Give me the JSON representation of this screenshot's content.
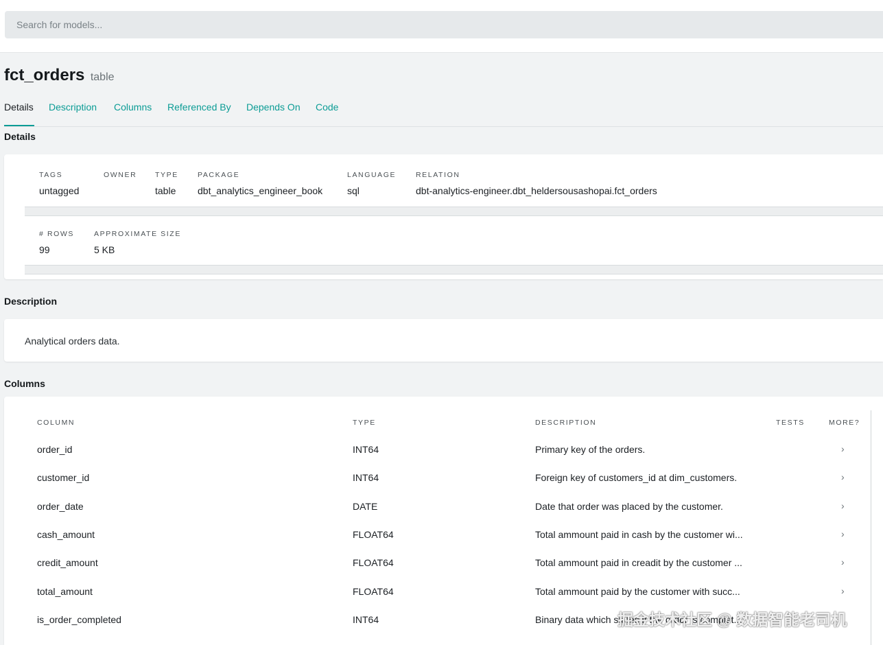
{
  "search": {
    "placeholder": "Search for models..."
  },
  "model": {
    "name": "fct_orders",
    "kind": "table"
  },
  "tabs": [
    {
      "label": "Details"
    },
    {
      "label": "Description"
    },
    {
      "label": "Columns"
    },
    {
      "label": "Referenced By"
    },
    {
      "label": "Depends On"
    },
    {
      "label": "Code"
    }
  ],
  "details": {
    "heading": "Details",
    "tags": {
      "label": "TAGS",
      "value": "untagged"
    },
    "owner": {
      "label": "OWNER",
      "value": ""
    },
    "type": {
      "label": "TYPE",
      "value": "table"
    },
    "package": {
      "label": "PACKAGE",
      "value": "dbt_analytics_engineer_book"
    },
    "language": {
      "label": "LANGUAGE",
      "value": "sql"
    },
    "relation": {
      "label": "RELATION",
      "value": "dbt-analytics-engineer.dbt_heldersousashopai.fct_orders"
    },
    "rows": {
      "label": "# ROWS",
      "value": "99"
    },
    "size": {
      "label": "APPROXIMATE SIZE",
      "value": "5 KB"
    }
  },
  "description": {
    "heading": "Description",
    "text": "Analytical orders data."
  },
  "columns": {
    "heading": "Columns",
    "headers": {
      "column": "COLUMN",
      "type": "TYPE",
      "description": "DESCRIPTION",
      "tests": "TESTS",
      "more": "MORE?"
    },
    "rows": [
      {
        "name": "order_id",
        "type": "INT64",
        "description": "Primary key of the orders.",
        "more": "›"
      },
      {
        "name": "customer_id",
        "type": "INT64",
        "description": "Foreign key of customers_id at dim_customers.",
        "more": "›"
      },
      {
        "name": "order_date",
        "type": "DATE",
        "description": "Date that order was placed by the customer.",
        "more": "›"
      },
      {
        "name": "cash_amount",
        "type": "FLOAT64",
        "description": "Total ammount paid in cash by the customer wi...",
        "more": "›"
      },
      {
        "name": "credit_amount",
        "type": "FLOAT64",
        "description": "Total ammount paid in creadit by the customer ...",
        "more": "›"
      },
      {
        "name": "total_amount",
        "type": "FLOAT64",
        "description": "Total ammount paid by the customer with succ...",
        "more": "›"
      },
      {
        "name": "is_order_completed",
        "type": "INT64",
        "description": "Binary data which states if the order is complet...",
        "more": ""
      }
    ]
  },
  "watermark": "掘金技术社区 @ 数据智能老司机"
}
